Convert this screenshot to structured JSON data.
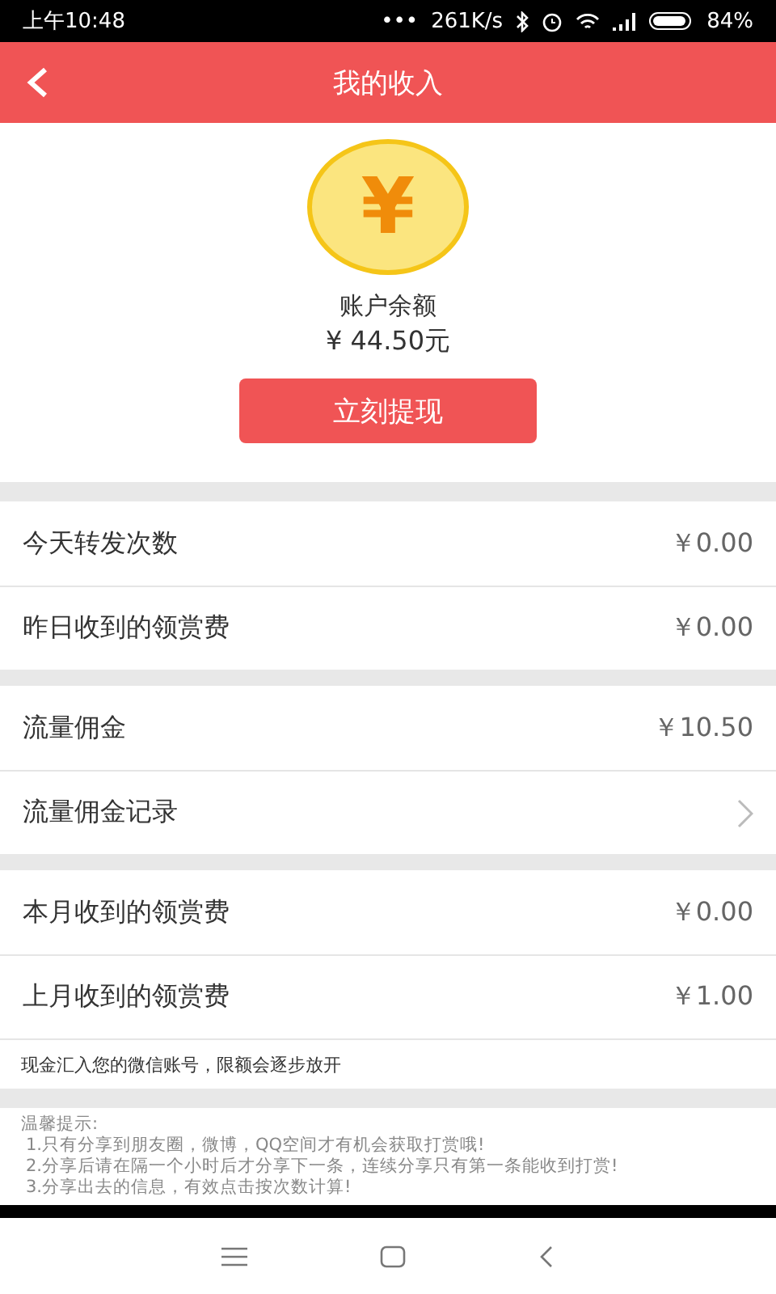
{
  "status_bar": {
    "time": "上午10:48",
    "dots": "•••",
    "speed": "261K/s",
    "battery": "84%"
  },
  "header": {
    "title": "我的收入"
  },
  "balance": {
    "coin_symbol": "¥",
    "label": "账户余额",
    "amount": "¥ 44.50元",
    "button": "立刻提现"
  },
  "groups": [
    [
      {
        "kind": "value",
        "label": "今天转发次数",
        "value": "￥0.00"
      },
      {
        "kind": "value",
        "label": "昨日收到的领赏费",
        "value": "￥0.00"
      }
    ],
    [
      {
        "kind": "value",
        "label": "流量佣金",
        "value": "￥10.50"
      },
      {
        "kind": "link",
        "label": "流量佣金记录"
      }
    ],
    [
      {
        "kind": "value",
        "label": "本月收到的领赏费",
        "value": "￥0.00"
      },
      {
        "kind": "value",
        "label": "上月收到的领赏费",
        "value": "￥1.00"
      }
    ]
  ],
  "note": "现金汇入您的微信账号，限额会逐步放开",
  "tips": {
    "title": "温馨提示:",
    "lines": [
      "1.只有分享到朋友圈，微博，QQ空间才有机会获取打赏哦!",
      "2.分享后请在隔一个小时后才分享下一条，连续分享只有第一条能收到打赏!",
      "3.分享出去的信息，有效点击按次数计算!"
    ]
  }
}
